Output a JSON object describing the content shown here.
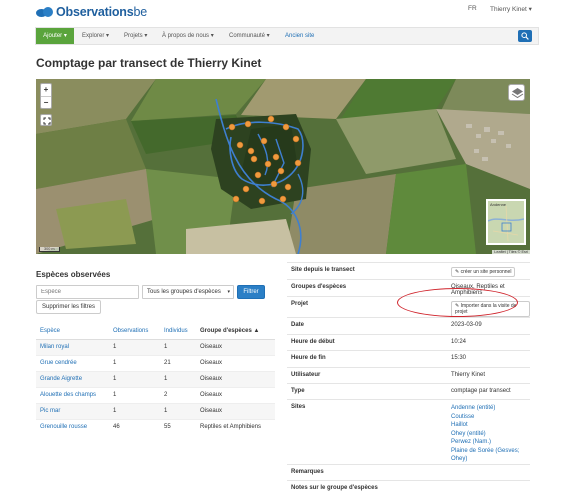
{
  "header": {
    "logo_main": "Observations",
    "logo_suffix": "be",
    "lang": "FR",
    "user": "Thierry Kinet ▾"
  },
  "nav": {
    "add_label": "Ajouter ▾",
    "items": [
      "Explorer ▾",
      "Projets ▾",
      "À propos de nous ▾",
      "Communauté ▾",
      "Ancien site"
    ]
  },
  "page": {
    "title": "Comptage par transect de Thierry Kinet"
  },
  "map": {
    "attribution": "Leaflet | Tiles © Esri",
    "scale": "300 m",
    "minimap_label": "Andenne"
  },
  "species_section": {
    "title": "Espèces observées",
    "search_placeholder": "Espèce",
    "group_select": "Tous les groupes d'espèces",
    "filter_button": "Filtrer",
    "clear_button": "Supprimer les filtres",
    "columns": [
      "Espèce",
      "Observations",
      "Individus",
      "Groupe d'espèces ▲"
    ],
    "rows": [
      {
        "species": "Milan royal",
        "observations": "1",
        "individuals": "1",
        "group": "Oiseaux"
      },
      {
        "species": "Grue cendrée",
        "observations": "1",
        "individuals": "21",
        "group": "Oiseaux"
      },
      {
        "species": "Grande Aigrette",
        "observations": "1",
        "individuals": "1",
        "group": "Oiseaux"
      },
      {
        "species": "Alouette des champs",
        "observations": "1",
        "individuals": "2",
        "group": "Oiseaux"
      },
      {
        "species": "Pic mar",
        "observations": "1",
        "individuals": "1",
        "group": "Oiseaux"
      },
      {
        "species": "Grenouille rousse",
        "observations": "46",
        "individuals": "55",
        "group": "Reptiles et Amphibiens"
      }
    ]
  },
  "details": {
    "site_label": "Site depuis le transect",
    "site_button": "✎ créer un site personnel",
    "groups_label": "Groupes d'espèces",
    "groups_value": "Oiseaux, Reptiles et Amphibiens",
    "project_label": "Projet",
    "project_button": "✎ Importer dans la visite de projet",
    "date_label": "Date",
    "date_value": "2023-03-09",
    "start_label": "Heure de début",
    "start_value": "10:24",
    "end_label": "Heure de fin",
    "end_value": "15:30",
    "user_label": "Utilisateur",
    "user_value": "Thierry Kinet",
    "type_label": "Type",
    "type_value": "comptage par transect",
    "sites_label": "Sites",
    "sites": [
      "Andenne (entité)",
      "Coutisse",
      "Haillot",
      "Ohey (entité)",
      "Perwez (Nam.)",
      "Plaine de Sorée (Gesves; Ohey)"
    ],
    "remarks_label": "Remarques",
    "group_notes_label": "Notes sur le groupe d'espèces"
  }
}
